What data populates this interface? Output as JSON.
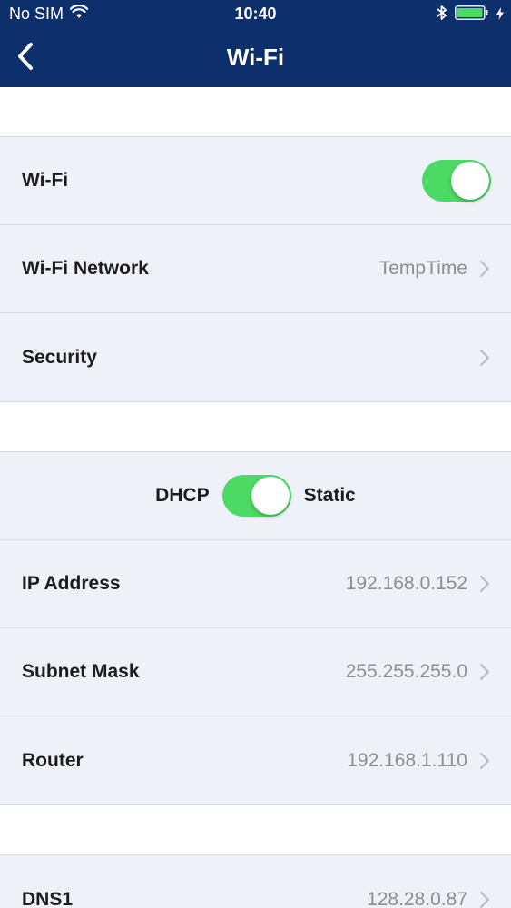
{
  "status_bar": {
    "carrier": "No SIM",
    "time": "10:40",
    "icons": [
      "wifi-signal-icon",
      "bluetooth-icon",
      "battery-icon",
      "charging-bolt-icon"
    ]
  },
  "nav": {
    "title": "Wi-Fi",
    "back_icon": "chevron-left-icon"
  },
  "colors": {
    "nav_bg": "#0d2f6c",
    "toggle_on": "#4cd964",
    "section_bg": "#eef1f8",
    "value_text": "#8b8e95"
  },
  "wifi_section": {
    "wifi": {
      "label": "Wi-Fi",
      "enabled": true
    },
    "network": {
      "label": "Wi-Fi Network",
      "value": "TempTime"
    },
    "security": {
      "label": "Security",
      "value": ""
    }
  },
  "ip_section": {
    "mode_left": "DHCP",
    "mode_right": "Static",
    "mode_static_selected": true,
    "rows": [
      {
        "label": "IP Address",
        "value": "192.168.0.152"
      },
      {
        "label": "Subnet Mask",
        "value": "255.255.255.0"
      },
      {
        "label": "Router",
        "value": "192.168.1.110"
      }
    ]
  },
  "dns_section": {
    "rows": [
      {
        "label": "DNS1",
        "value": "128.28.0.87"
      }
    ]
  }
}
